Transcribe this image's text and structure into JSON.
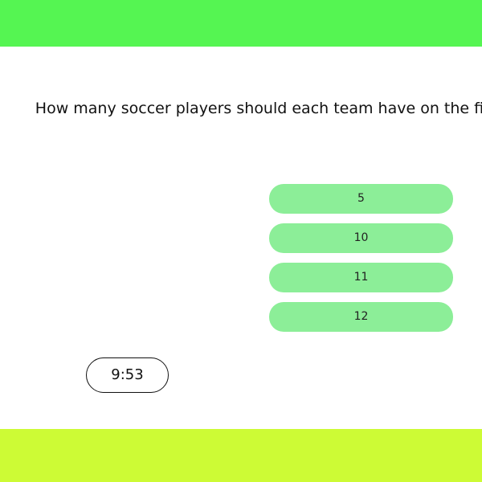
{
  "colors": {
    "top_bar": "#55f552",
    "bottom_bar": "#cdfb35",
    "answer_background": "#8cee98",
    "text": "#111111"
  },
  "quiz": {
    "question": "How many soccer players should each team have on the field at the start of each match?",
    "answers": [
      {
        "label": "5"
      },
      {
        "label": "10"
      },
      {
        "label": "11"
      },
      {
        "label": "12"
      }
    ],
    "timer": "9:53"
  }
}
